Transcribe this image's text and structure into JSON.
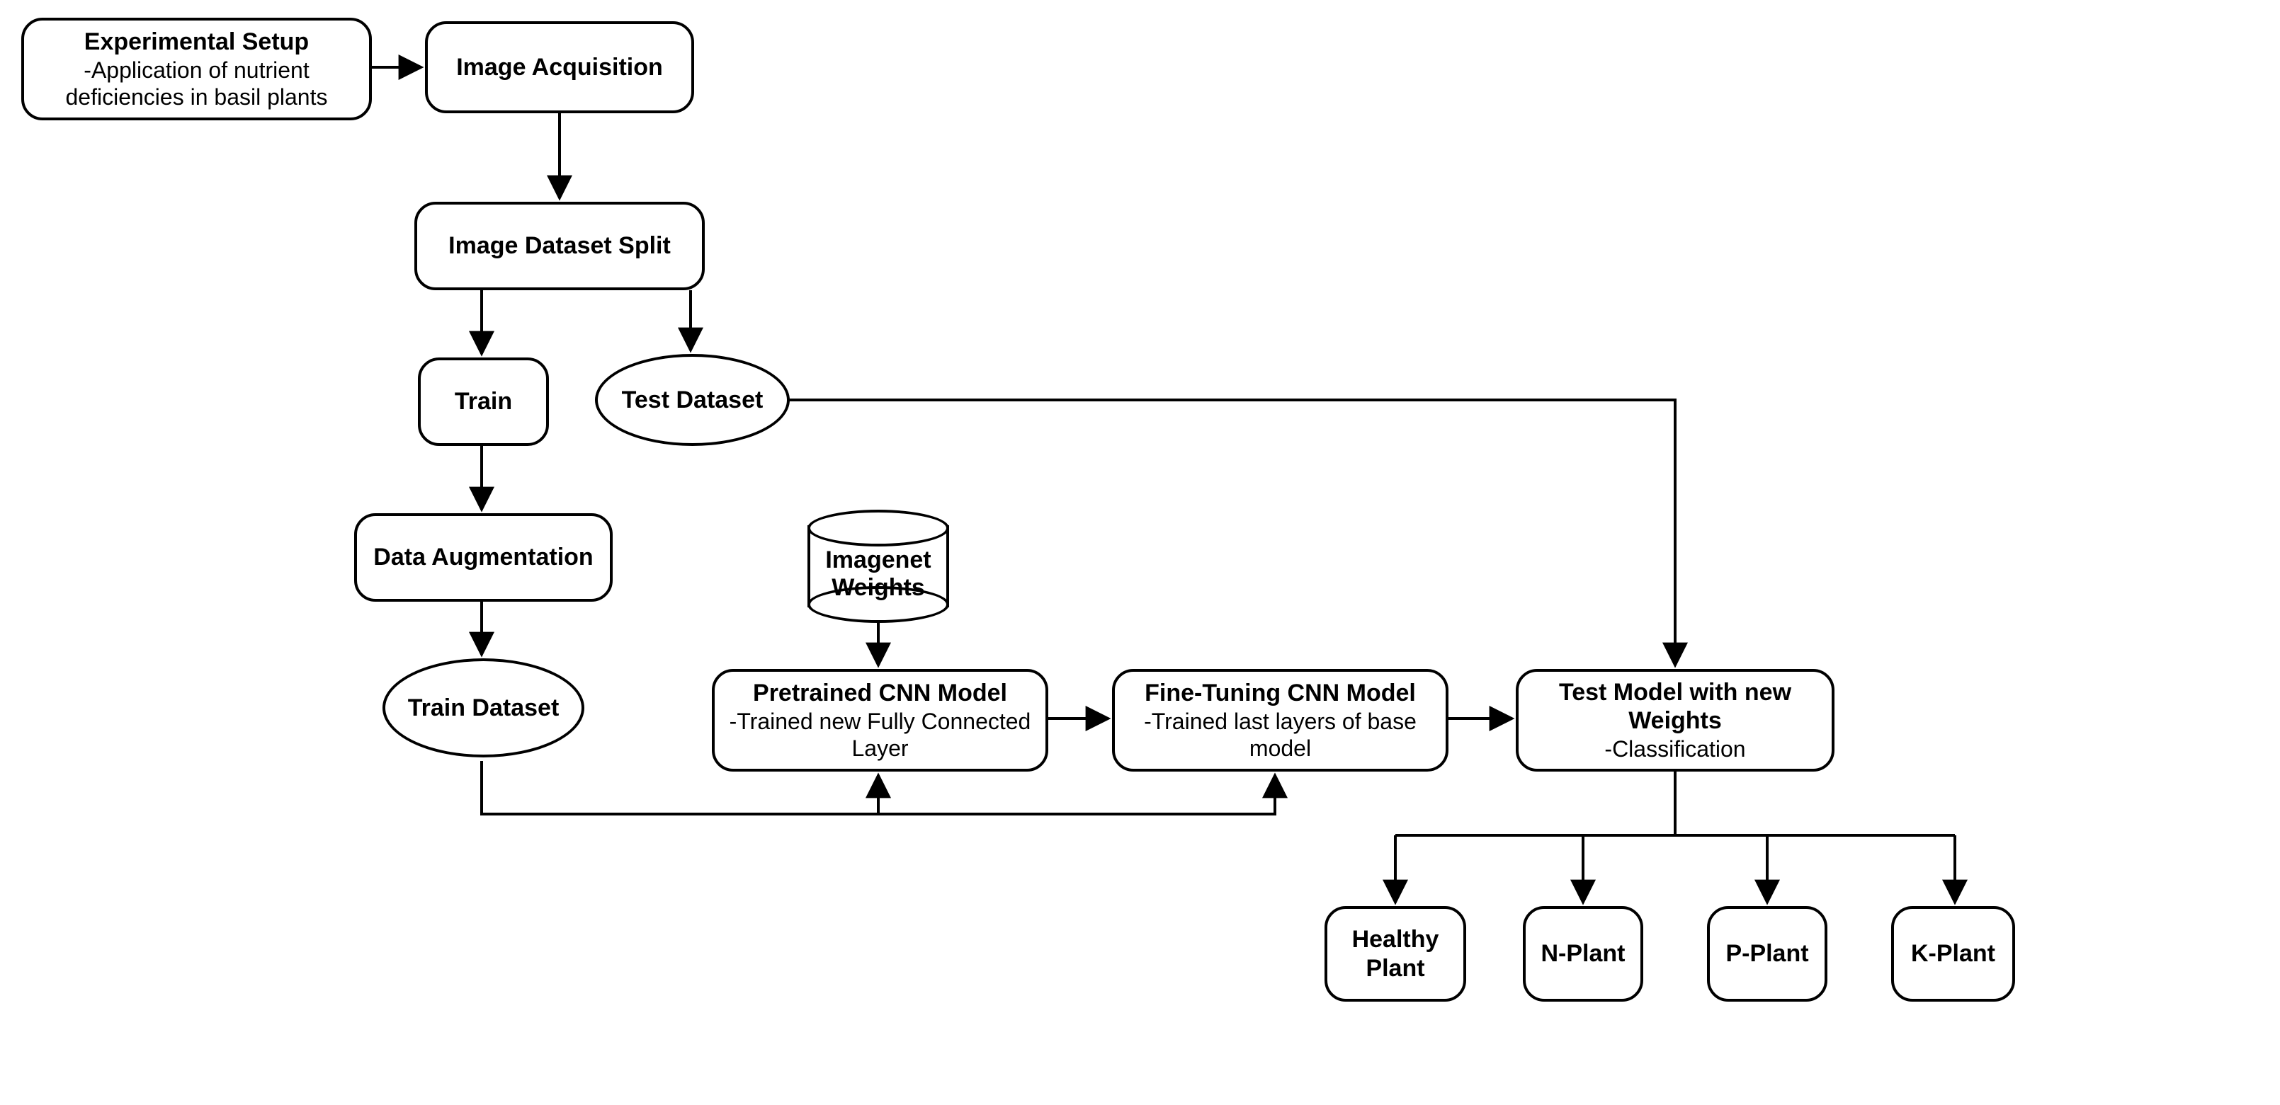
{
  "nodes": {
    "experimental_setup": {
      "title": "Experimental Setup",
      "sub": "-Application of nutrient deficiencies in basil plants"
    },
    "image_acquisition": {
      "title": "Image Acquisition"
    },
    "image_dataset_split": {
      "title": "Image Dataset Split"
    },
    "train": {
      "title": "Train"
    },
    "test_dataset": {
      "title": "Test Dataset"
    },
    "data_augmentation": {
      "title": "Data Augmentation"
    },
    "train_dataset": {
      "title": "Train Dataset"
    },
    "imagenet_weights": {
      "title": "Imagenet Weights"
    },
    "pretrained_cnn": {
      "title": "Pretrained CNN Model",
      "sub": "-Trained new Fully Connected Layer"
    },
    "fine_tuning_cnn": {
      "title": "Fine-Tuning CNN Model",
      "sub": "-Trained last layers of base model"
    },
    "test_model": {
      "title": "Test Model with new Weights",
      "sub": "-Classification"
    },
    "healthy_plant": {
      "title": "Healthy Plant"
    },
    "n_plant": {
      "title": "N-Plant"
    },
    "p_plant": {
      "title": "P-Plant"
    },
    "k_plant": {
      "title": "K-Plant"
    }
  }
}
